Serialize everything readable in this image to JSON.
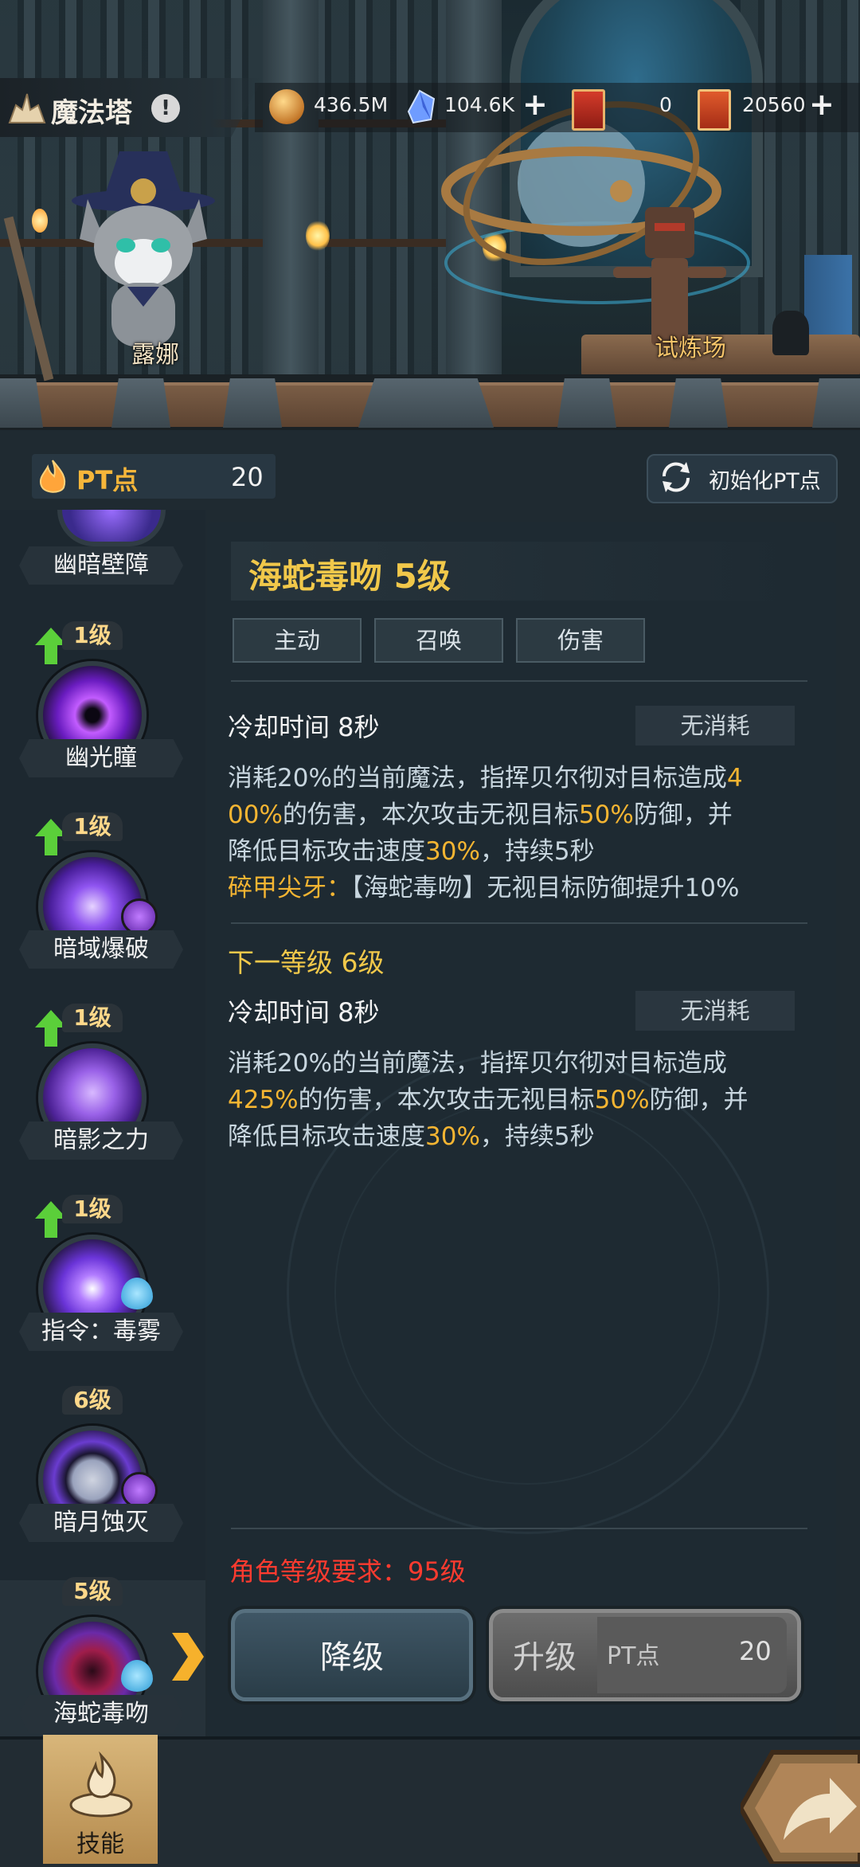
{
  "header": {
    "title": "魔法塔",
    "info_icon": "info-exclamation-icon",
    "resources": [
      {
        "icon": "gold-coin-icon",
        "value": "436.5M"
      },
      {
        "icon": "crystal-icon",
        "value": "104.6K",
        "has_plus": true
      },
      {
        "icon": "red-ticket-icon",
        "value": "0"
      },
      {
        "icon": "orange-ticket-icon",
        "value": "20560",
        "has_plus": true
      }
    ]
  },
  "scene": {
    "npc_left": "露娜",
    "npc_right": "试炼场"
  },
  "pt": {
    "label": "PT点",
    "value": "20",
    "reset_label": "初始化PT点"
  },
  "skills": [
    {
      "name": "幽暗壁障",
      "level": ""
    },
    {
      "name": "幽光瞳",
      "level": "1级",
      "upgradable": true
    },
    {
      "name": "暗域爆破",
      "level": "1级",
      "upgradable": true,
      "badge": "purple"
    },
    {
      "name": "暗影之力",
      "level": "1级",
      "upgradable": true
    },
    {
      "name": "指令：毒雾",
      "level": "1级",
      "upgradable": true,
      "badge": "blue"
    },
    {
      "name": "暗月蚀灭",
      "level": "6级",
      "badge": "purple"
    },
    {
      "name": "海蛇毒吻",
      "level": "5级",
      "badge": "blue",
      "selected": true
    }
  ],
  "detail": {
    "title": "海蛇毒吻 5级",
    "tags": [
      "主动",
      "召唤",
      "伤害"
    ],
    "current": {
      "cooldown": "冷却时间 8秒",
      "cost": "无消耗",
      "desc_lines": [
        [
          {
            "t": "消耗20%的当前魔法，指挥贝尔彻对目标造成"
          },
          {
            "t": "4",
            "hl": true
          }
        ],
        [
          {
            "t": "00%",
            "hl": true
          },
          {
            "t": "的伤害，本次攻击无视目标"
          },
          {
            "t": "50%",
            "hl": true
          },
          {
            "t": "防御，并"
          }
        ],
        [
          {
            "t": "降低目标攻击速度"
          },
          {
            "t": "30%",
            "hl": true
          },
          {
            "t": "，持续5秒"
          }
        ],
        [
          {
            "t": "碎甲尖牙：",
            "hl": true
          },
          {
            "t": "【海蛇毒吻】无视目标防御提升10%"
          }
        ]
      ]
    },
    "next": {
      "heading": "下一等级 6级",
      "cooldown": "冷却时间 8秒",
      "cost": "无消耗",
      "desc_lines": [
        [
          {
            "t": "消耗20%的当前魔法，指挥贝尔彻对目标造成"
          }
        ],
        [
          {
            "t": "425%",
            "hl": true
          },
          {
            "t": "的伤害，本次攻击无视目标"
          },
          {
            "t": "50%",
            "hl": true
          },
          {
            "t": "防御，并"
          }
        ],
        [
          {
            "t": "降低目标攻击速度"
          },
          {
            "t": "30%",
            "hl": true
          },
          {
            "t": "，持续5秒"
          }
        ]
      ]
    },
    "requirement": "角色等级要求：95级",
    "downgrade_label": "降级",
    "upgrade_label": "升级",
    "upgrade_cost_label": "PT点",
    "upgrade_cost_value": "20"
  },
  "bottom_nav": {
    "skills_tab": "技能"
  },
  "colors": {
    "highlight": "#f5b532",
    "title_gold": "#f1c84a",
    "requirement_red": "#ff3b2f"
  }
}
